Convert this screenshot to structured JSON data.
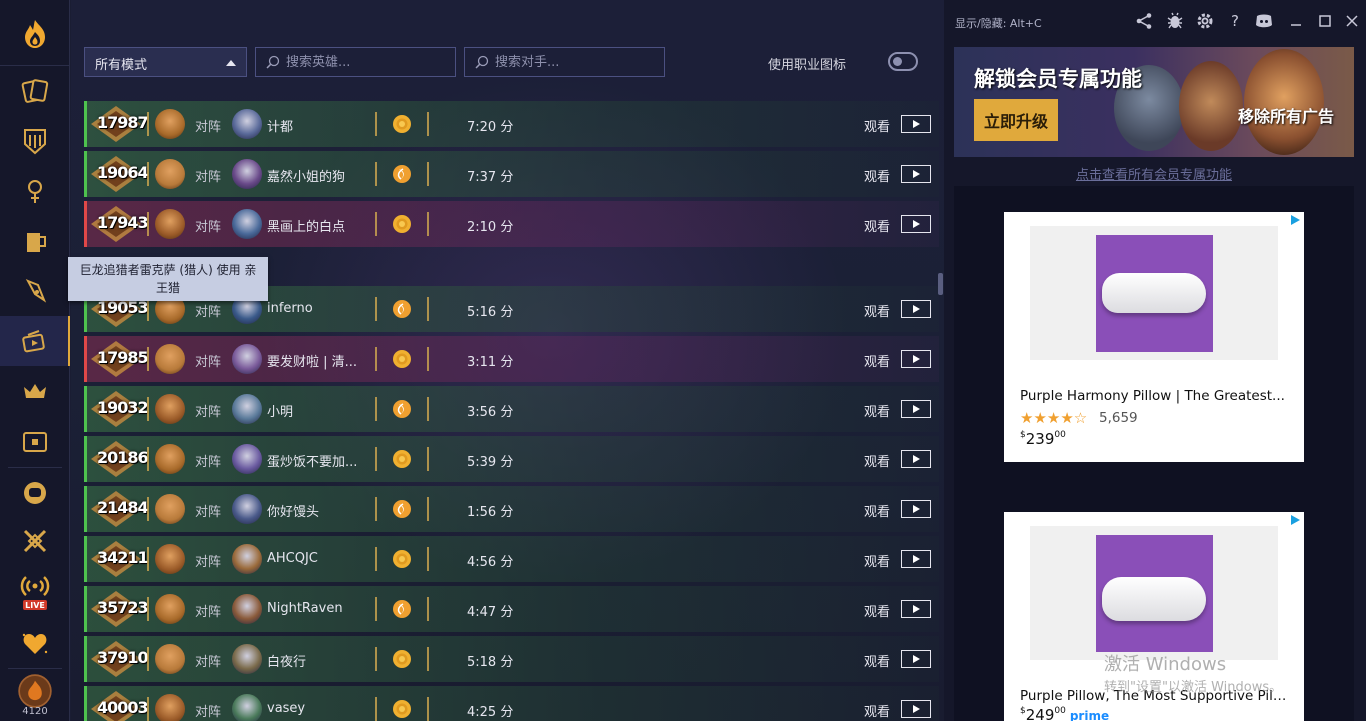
{
  "titlebar": {
    "toggle_hint": "显示/隐藏: Alt+C"
  },
  "sidebar": {
    "items": [
      {
        "name": "cards",
        "icon": "cards-icon"
      },
      {
        "name": "decks",
        "icon": "deck-shield-icon"
      },
      {
        "name": "tavern",
        "icon": "tavern-icon"
      },
      {
        "name": "arena",
        "icon": "mug-icon"
      },
      {
        "name": "battlegrounds",
        "icon": "pen-icon"
      },
      {
        "name": "replays",
        "icon": "replay-video-icon",
        "active": true
      },
      {
        "name": "rankings",
        "icon": "crown-icon"
      },
      {
        "name": "collection",
        "icon": "chest-icon"
      },
      {
        "name": "guild",
        "icon": "fist-icon"
      },
      {
        "name": "battles",
        "icon": "crossed-swords-icon"
      },
      {
        "name": "live",
        "icon": "live-icon",
        "label": "LIVE"
      },
      {
        "name": "favorites",
        "icon": "heart-icon"
      }
    ],
    "user_level": "4120"
  },
  "filters": {
    "mode_selected": "所有模式",
    "hero_search_placeholder": "搜索英雄...",
    "opponent_search_placeholder": "搜索对手...",
    "class_icon_toggle_label": "使用职业图标",
    "class_icon_toggle_on": false
  },
  "row_common": {
    "vs_label": "对阵",
    "watch_label": "观看"
  },
  "replays": [
    {
      "rank": "17987",
      "opponent": "计都",
      "result": "win",
      "coin": "coin",
      "duration": "7:20 分"
    },
    {
      "rank": "19064",
      "opponent": "嘉然小姐的狗",
      "result": "win",
      "coin": "first",
      "duration": "7:37 分"
    },
    {
      "rank": "17943",
      "opponent": "黑画上的白点",
      "result": "loss",
      "coin": "coin",
      "duration": "2:10 分"
    },
    {
      "rank": "19053",
      "opponent": "inferno",
      "result": "win",
      "coin": "first",
      "duration": "5:16 分"
    },
    {
      "rank": "17985",
      "opponent": "要发财啦 | 清...",
      "result": "loss",
      "coin": "coin",
      "duration": "3:11 分"
    },
    {
      "rank": "19032",
      "opponent": "小明",
      "result": "win",
      "coin": "first",
      "duration": "3:56 分"
    },
    {
      "rank": "20186",
      "opponent": "蛋炒饭不要加...",
      "result": "win",
      "coin": "coin",
      "duration": "5:39 分"
    },
    {
      "rank": "21484",
      "opponent": "你好馒头",
      "result": "win",
      "coin": "first",
      "duration": "1:56 分"
    },
    {
      "rank": "34211",
      "opponent": "AHCQJC",
      "result": "win",
      "coin": "coin",
      "duration": "4:56 分"
    },
    {
      "rank": "35723",
      "opponent": "NightRaven",
      "result": "win",
      "coin": "first",
      "duration": "4:47 分"
    },
    {
      "rank": "37910",
      "opponent": "白夜行",
      "result": "win",
      "coin": "coin",
      "duration": "5:18 分"
    },
    {
      "rank": "40003",
      "opponent": "vasey",
      "result": "win",
      "coin": "coin",
      "duration": "4:25 分"
    }
  ],
  "tooltip": {
    "text": "巨龙追猎者雷克萨 (猎人) 使用 亲王猎"
  },
  "banner": {
    "title": "解锁会员专属功能",
    "upgrade_button": "立即升级",
    "remove_ads": "移除所有广告",
    "member_link": "点击查看所有会员专属功能"
  },
  "ads": [
    {
      "title": "Purple Harmony Pillow | The Greatest...",
      "stars": "★★★★☆",
      "reviews": "5,659",
      "price_currency": "$",
      "price_main": "239",
      "price_cents": "00",
      "prime": false
    },
    {
      "title": "Purple Pillow, The Most Supportive Pillo...",
      "stars": "",
      "reviews": "",
      "price_currency": "$",
      "price_main": "249",
      "price_cents": "00",
      "prime": true,
      "prime_label": "prime"
    }
  ],
  "watermark": {
    "line1": "激活 Windows",
    "line2": "转到\"设置\"以激活 Windows。"
  },
  "colors": {
    "win": "#4ec24e",
    "loss": "#e04848",
    "accent": "#e0a93c"
  }
}
